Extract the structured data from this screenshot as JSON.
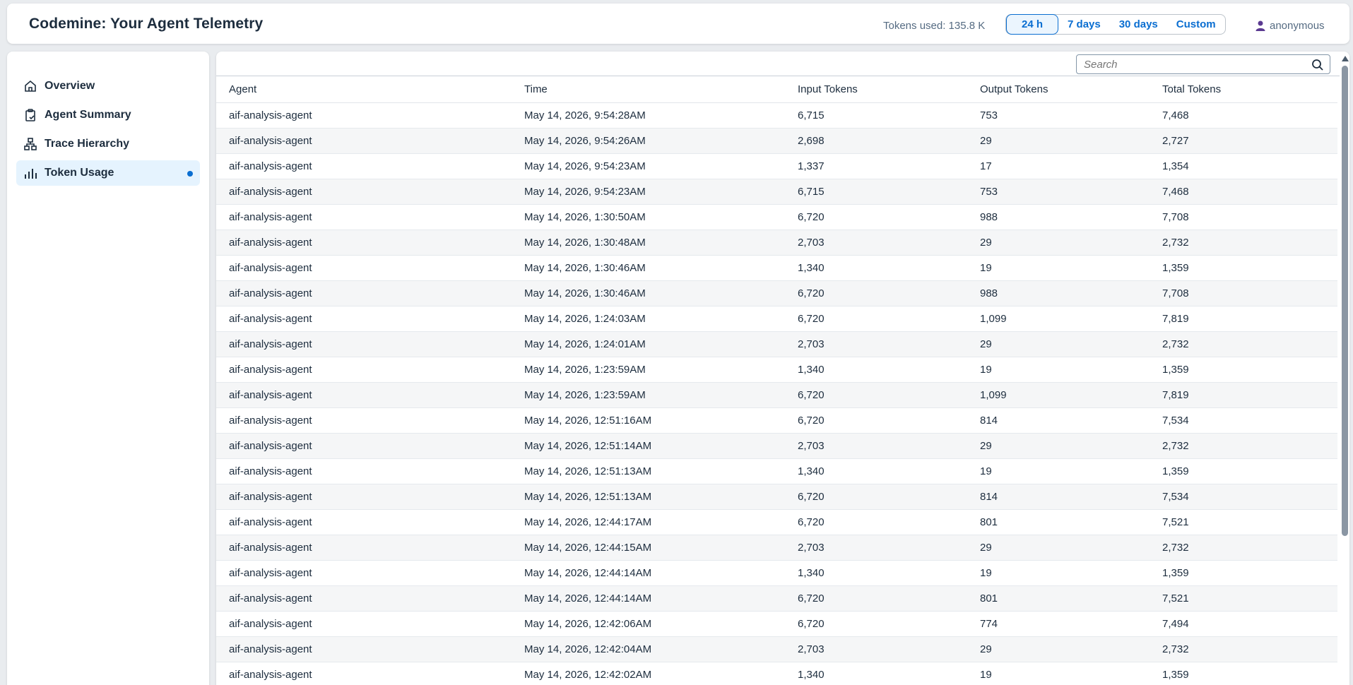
{
  "header": {
    "title": "Codemine: Your Agent Telemetry",
    "tokens_used": "Tokens used: 135.8 K",
    "ranges": [
      "24 h",
      "7 days",
      "30 days",
      "Custom"
    ],
    "active_range": "24 h",
    "user": "anonymous"
  },
  "sidebar": {
    "items": [
      {
        "label": "Overview",
        "icon": "home-icon"
      },
      {
        "label": "Agent Summary",
        "icon": "clipboard-check-icon"
      },
      {
        "label": "Trace Hierarchy",
        "icon": "hierarchy-icon"
      },
      {
        "label": "Token Usage",
        "icon": "bar-chart-icon"
      }
    ],
    "active": "Token Usage"
  },
  "search": {
    "placeholder": "Search"
  },
  "table": {
    "columns": [
      "Agent",
      "Time",
      "Input Tokens",
      "Output Tokens",
      "Total Tokens"
    ],
    "rows": [
      [
        "aif-analysis-agent",
        "May 14, 2026, 9:54:28AM",
        "6,715",
        "753",
        "7,468"
      ],
      [
        "aif-analysis-agent",
        "May 14, 2026, 9:54:26AM",
        "2,698",
        "29",
        "2,727"
      ],
      [
        "aif-analysis-agent",
        "May 14, 2026, 9:54:23AM",
        "1,337",
        "17",
        "1,354"
      ],
      [
        "aif-analysis-agent",
        "May 14, 2026, 9:54:23AM",
        "6,715",
        "753",
        "7,468"
      ],
      [
        "aif-analysis-agent",
        "May 14, 2026, 1:30:50AM",
        "6,720",
        "988",
        "7,708"
      ],
      [
        "aif-analysis-agent",
        "May 14, 2026, 1:30:48AM",
        "2,703",
        "29",
        "2,732"
      ],
      [
        "aif-analysis-agent",
        "May 14, 2026, 1:30:46AM",
        "1,340",
        "19",
        "1,359"
      ],
      [
        "aif-analysis-agent",
        "May 14, 2026, 1:30:46AM",
        "6,720",
        "988",
        "7,708"
      ],
      [
        "aif-analysis-agent",
        "May 14, 2026, 1:24:03AM",
        "6,720",
        "1,099",
        "7,819"
      ],
      [
        "aif-analysis-agent",
        "May 14, 2026, 1:24:01AM",
        "2,703",
        "29",
        "2,732"
      ],
      [
        "aif-analysis-agent",
        "May 14, 2026, 1:23:59AM",
        "1,340",
        "19",
        "1,359"
      ],
      [
        "aif-analysis-agent",
        "May 14, 2026, 1:23:59AM",
        "6,720",
        "1,099",
        "7,819"
      ],
      [
        "aif-analysis-agent",
        "May 14, 2026, 12:51:16AM",
        "6,720",
        "814",
        "7,534"
      ],
      [
        "aif-analysis-agent",
        "May 14, 2026, 12:51:14AM",
        "2,703",
        "29",
        "2,732"
      ],
      [
        "aif-analysis-agent",
        "May 14, 2026, 12:51:13AM",
        "1,340",
        "19",
        "1,359"
      ],
      [
        "aif-analysis-agent",
        "May 14, 2026, 12:51:13AM",
        "6,720",
        "814",
        "7,534"
      ],
      [
        "aif-analysis-agent",
        "May 14, 2026, 12:44:17AM",
        "6,720",
        "801",
        "7,521"
      ],
      [
        "aif-analysis-agent",
        "May 14, 2026, 12:44:15AM",
        "2,703",
        "29",
        "2,732"
      ],
      [
        "aif-analysis-agent",
        "May 14, 2026, 12:44:14AM",
        "1,340",
        "19",
        "1,359"
      ],
      [
        "aif-analysis-agent",
        "May 14, 2026, 12:44:14AM",
        "6,720",
        "801",
        "7,521"
      ],
      [
        "aif-analysis-agent",
        "May 14, 2026, 12:42:06AM",
        "6,720",
        "774",
        "7,494"
      ],
      [
        "aif-analysis-agent",
        "May 14, 2026, 12:42:04AM",
        "2,703",
        "29",
        "2,732"
      ],
      [
        "aif-analysis-agent",
        "May 14, 2026, 12:42:02AM",
        "1,340",
        "19",
        "1,359"
      ]
    ]
  },
  "colors": {
    "accent": "#0a6ed1",
    "active_nav_bg": "#e5f3fe",
    "page_bg": "#e9ecef"
  }
}
